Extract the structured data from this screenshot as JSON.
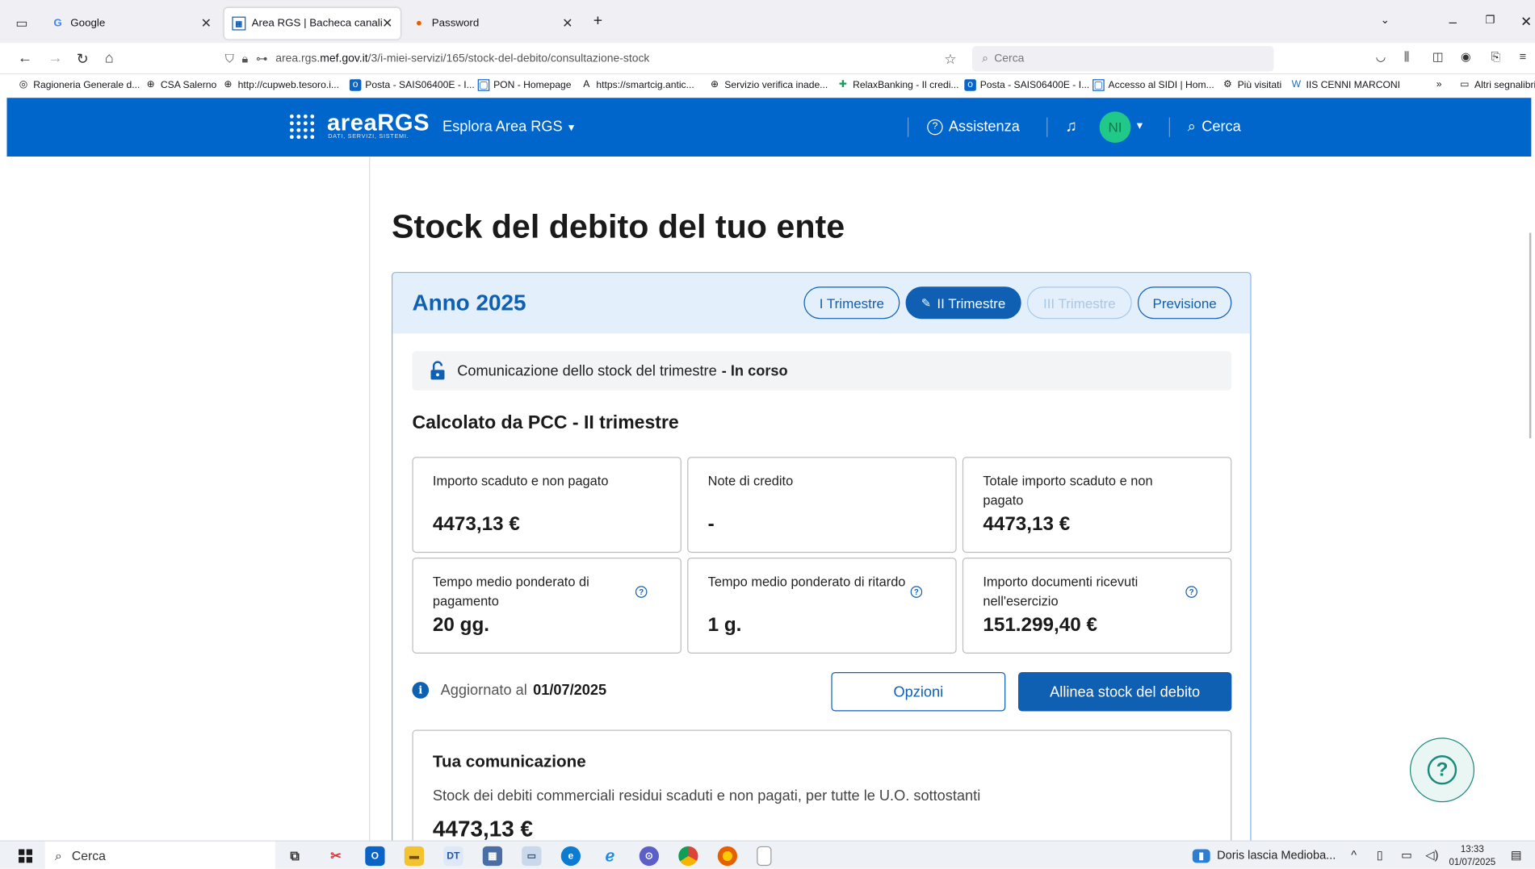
{
  "browser": {
    "tabs": [
      {
        "label": "Google",
        "icon": "google-icon"
      },
      {
        "label": "Area RGS | Bacheca canali",
        "icon": "rgs-icon"
      },
      {
        "label": "Password",
        "icon": "firefox-icon"
      }
    ],
    "url_prefix": "area.rgs.",
    "url_domain": "mef.gov.it",
    "url_path": "/3/i-miei-servizi/165/stock-del-debito/consultazione-stock",
    "search_placeholder": "Cerca",
    "bookmarks": [
      "Ragioneria Generale d...",
      "CSA Salerno",
      "http://cupweb.tesoro.i...",
      "Posta - SAIS06400E - I...",
      "PON - Homepage",
      "https://smartcig.antic...",
      "Servizio verifica inade...",
      "RelaxBanking - Il credi...",
      "Posta - SAIS06400E - I...",
      "Accesso al SIDI | Hom...",
      "Più visitati",
      "IIS CENNI MARCONI"
    ],
    "other_bookmarks": "Altri segnalibri"
  },
  "header": {
    "logo": "areaRGS",
    "logo_sub": "DATI, SERVIZI, SISTEMI.",
    "explore": "Esplora Area RGS",
    "assistance": "Assistenza",
    "avatar_initials": "NI",
    "search": "Cerca"
  },
  "page": {
    "title": "Stock del debito del tuo ente",
    "year": "Anno 2025",
    "quarters": [
      {
        "label": "I Trimestre",
        "state": "default"
      },
      {
        "label": "II Trimestre",
        "state": "active"
      },
      {
        "label": "III Trimestre",
        "state": "disabled"
      },
      {
        "label": "Previsione",
        "state": "default"
      }
    ],
    "notice_text": "Comunicazione dello stock del trimestre",
    "notice_status": "- In corso",
    "section_title": "Calcolato da PCC - II trimestre",
    "stats": [
      {
        "label": "Importo scaduto e non pagato",
        "value": "4473,13 €",
        "help": false
      },
      {
        "label": "Note di credito",
        "value": "-",
        "help": false
      },
      {
        "label": "Totale importo scaduto e non pagato",
        "value": "4473,13 €",
        "help": false
      },
      {
        "label": "Tempo medio ponderato di pagamento",
        "value": "20 gg.",
        "help": true
      },
      {
        "label": "Tempo medio ponderato di ritardo",
        "value": "1 g.",
        "help": true
      },
      {
        "label": "Importo documenti ricevuti nell'esercizio",
        "value": "151.299,40 €",
        "help": true
      }
    ],
    "updated_label": "Aggiornato al",
    "updated_date": "01/07/2025",
    "options_button": "Opzioni",
    "align_button": "Allinea stock del debito",
    "communication": {
      "title": "Tua comunicazione",
      "description": "Stock dei debiti commerciali residui scaduti e non pagati, per tutte le U.O. sottostanti",
      "value": "4473,13 €"
    }
  },
  "taskbar": {
    "search": "Cerca",
    "news": "Doris lascia Medioba...",
    "time": "13:33",
    "date": "01/07/2025"
  },
  "colors": {
    "brand_blue": "#0066cc",
    "accent": "#0f5fb3",
    "avatar": "#20c98a"
  }
}
